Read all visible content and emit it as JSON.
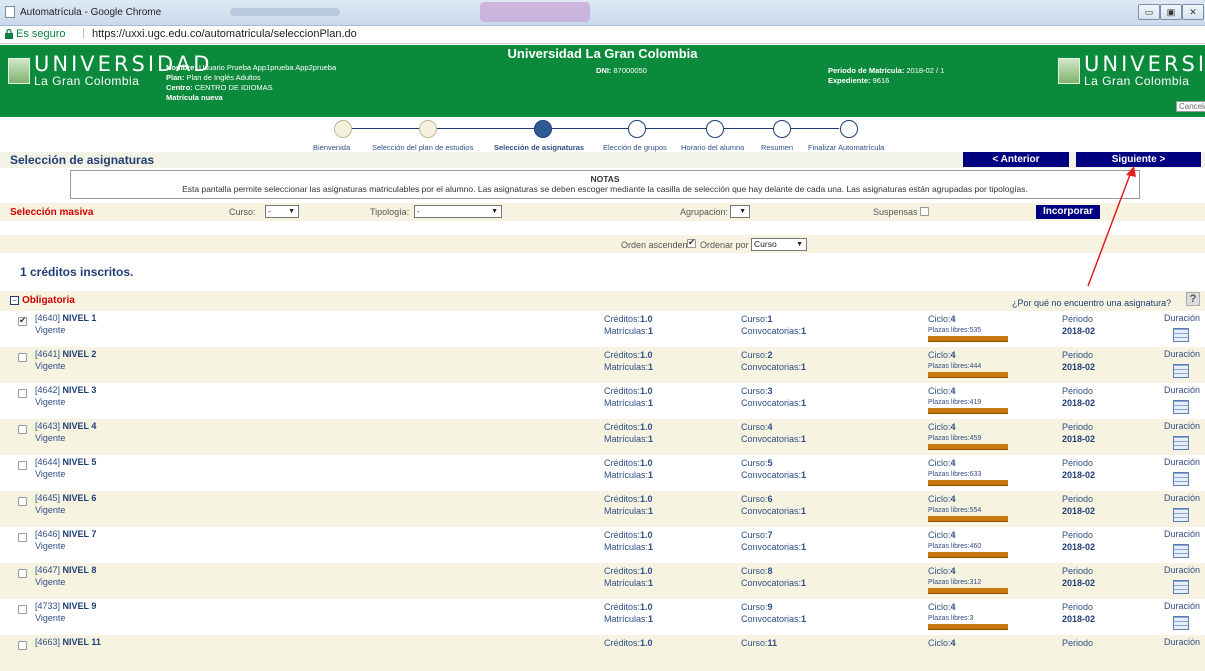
{
  "browser": {
    "window_title": "Automatrícula - Google Chrome",
    "secure_label": "Es seguro",
    "url": "https://uxxi.ugc.edu.co/automatricula/seleccionPlan.do"
  },
  "header": {
    "university_title": "Universidad La Gran Colombia",
    "logo_big": "UNIVERSIDAD",
    "logo_small": "La Gran Colombia",
    "nombre_label": "Nombre:",
    "nombre_value": "Usuario Prueba App1prueba App2prueba",
    "plan_label": "Plan:",
    "plan_value": "Plan de Inglés Adultos",
    "centro_label": "Centro:",
    "centro_value": "CENTRO DE IDIOMAS",
    "matricula": "Matrícula nueva",
    "dni_label": "DNI:",
    "dni_value": "87000050",
    "periodo_label": "Periodo de Matrícula:",
    "periodo_value": "2018-02 / 1",
    "expediente_label": "Expediente:",
    "expediente_value": "9616",
    "cancel_label": "Cancelar"
  },
  "steps": [
    {
      "label": "Bienvenida",
      "state": "done"
    },
    {
      "label": "Selección del plan de estudios",
      "state": "done"
    },
    {
      "label": "Selección de asignaturas",
      "state": "current"
    },
    {
      "label": "Elección de grupos",
      "state": "pending"
    },
    {
      "label": "Horario del alumno",
      "state": "pending"
    },
    {
      "label": "Resumen",
      "state": "pending"
    },
    {
      "label": "Finalizar Automatrícula",
      "state": "pending"
    }
  ],
  "section": {
    "title": "Selección de asignaturas",
    "prev_label": "< Anterior",
    "next_label": "Siguiente >"
  },
  "notes": {
    "title": "NOTAS",
    "text": "Esta pantalla permite seleccionar las asignaturas matriculables por el alumno. Las asignaturas se deben escoger mediante la casilla de selección que hay delante de cada una. Las asignaturas están agrupadas por tipologías."
  },
  "masiva": {
    "title": "Selección masiva",
    "curso_label": "Curso:",
    "curso_value": "-",
    "tipologia_label": "Tipología:",
    "tipologia_value": "-",
    "agrupacion_label": "Agrupacion:",
    "agrupacion_value": "",
    "suspensas_label": "Suspensas",
    "incorporar_label": "Incorporar"
  },
  "orden": {
    "asc_label": "Orden ascendente",
    "asc_checked": true,
    "ordenar_label": "Ordenar por",
    "ordenar_value": "Curso"
  },
  "creditos_inscritos": "1 créditos inscritos.",
  "group": {
    "toggle": "−",
    "title": "Obligatoria",
    "why_label": "¿Por qué no encuentro una asignatura?",
    "help_label": "?"
  },
  "labels": {
    "creditos": "Créditos:",
    "matriculas": "Matrículas:",
    "curso": "Curso:",
    "convocatorias": "Convocatorias:",
    "ciclo": "Ciclo:",
    "periodo": "Periodo",
    "duracion": "Duración"
  },
  "subjects": [
    {
      "code": "[4640]",
      "name": "NIVEL 1",
      "status": "Vigente",
      "creditos": "1.0",
      "matriculas": "1",
      "curso": "1",
      "convocatorias": "1",
      "ciclo": "4",
      "plazas": "Plazas libres:535",
      "periodo": "2018-02",
      "checked": true
    },
    {
      "code": "[4641]",
      "name": "NIVEL 2",
      "status": "Vigente",
      "creditos": "1.0",
      "matriculas": "1",
      "curso": "2",
      "convocatorias": "1",
      "ciclo": "4",
      "plazas": "Plazas libres:444",
      "periodo": "2018-02",
      "checked": false
    },
    {
      "code": "[4642]",
      "name": "NIVEL 3",
      "status": "Vigente",
      "creditos": "1.0",
      "matriculas": "1",
      "curso": "3",
      "convocatorias": "1",
      "ciclo": "4",
      "plazas": "Plazas libres:419",
      "periodo": "2018-02",
      "checked": false
    },
    {
      "code": "[4643]",
      "name": "NIVEL 4",
      "status": "Vigente",
      "creditos": "1.0",
      "matriculas": "1",
      "curso": "4",
      "convocatorias": "1",
      "ciclo": "4",
      "plazas": "Plazas libres:459",
      "periodo": "2018-02",
      "checked": false
    },
    {
      "code": "[4644]",
      "name": "NIVEL 5",
      "status": "Vigente",
      "creditos": "1.0",
      "matriculas": "1",
      "curso": "5",
      "convocatorias": "1",
      "ciclo": "4",
      "plazas": "Plazas libres:633",
      "periodo": "2018-02",
      "checked": false
    },
    {
      "code": "[4645]",
      "name": "NIVEL 6",
      "status": "Vigente",
      "creditos": "1.0",
      "matriculas": "1",
      "curso": "6",
      "convocatorias": "1",
      "ciclo": "4",
      "plazas": "Plazas libres:554",
      "periodo": "2018-02",
      "checked": false
    },
    {
      "code": "[4646]",
      "name": "NIVEL 7",
      "status": "Vigente",
      "creditos": "1.0",
      "matriculas": "1",
      "curso": "7",
      "convocatorias": "1",
      "ciclo": "4",
      "plazas": "Plazas libres:460",
      "periodo": "2018-02",
      "checked": false
    },
    {
      "code": "[4647]",
      "name": "NIVEL 8",
      "status": "Vigente",
      "creditos": "1.0",
      "matriculas": "1",
      "curso": "8",
      "convocatorias": "1",
      "ciclo": "4",
      "plazas": "Plazas libres:312",
      "periodo": "2018-02",
      "checked": false
    },
    {
      "code": "[4733]",
      "name": "NIVEL 9",
      "status": "Vigente",
      "creditos": "1.0",
      "matriculas": "1",
      "curso": "9",
      "convocatorias": "1",
      "ciclo": "4",
      "plazas": "Plazas libres:3",
      "periodo": "2018-02",
      "checked": false
    },
    {
      "code": "[4663]",
      "name": "NIVEL 11",
      "status": "",
      "creditos": "1.0",
      "matriculas": "",
      "curso": "11",
      "convocatorias": "",
      "ciclo": "4",
      "plazas": "",
      "periodo": "",
      "checked": false
    }
  ],
  "colors": {
    "header_green": "#0c8a3b",
    "nav_blue": "#000080",
    "accent_red": "#cc0000",
    "arrow_red": "#e02020"
  }
}
